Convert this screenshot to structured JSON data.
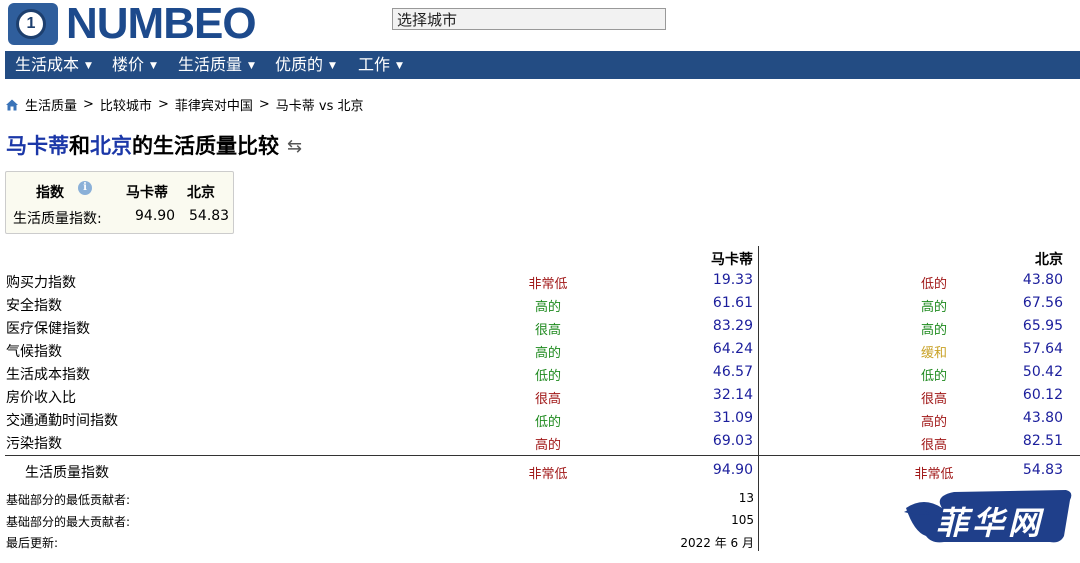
{
  "logo": {
    "text": "NUMBEO",
    "badge_glyph": "1"
  },
  "search": {
    "value": "选择城市"
  },
  "nav": [
    {
      "label": "生活成本"
    },
    {
      "label": "楼价"
    },
    {
      "label": "生活质量"
    },
    {
      "label": "优质的"
    },
    {
      "label": "工作"
    }
  ],
  "breadcrumb": [
    {
      "label": "生活质量"
    },
    {
      "label": "比较城市"
    },
    {
      "label": "菲律宾对中国"
    },
    {
      "label": "马卡蒂 vs 北京"
    }
  ],
  "title": {
    "city1": "马卡蒂",
    "conj": "和",
    "city2": "北京",
    "suffix": "的生活质量比较"
  },
  "summary": {
    "header_index": "指数",
    "header_city1": "马卡蒂",
    "header_city2": "北京",
    "label": "生活质量指数:",
    "value1": "94.90",
    "value2": "54.83"
  },
  "table": {
    "city1": "马卡蒂",
    "city2": "北京",
    "rows": [
      {
        "label": "购买力指数",
        "q1": "非常低",
        "q1_color": "#a01818",
        "v1": "19.33",
        "q2": "低的",
        "q2_color": "#a01818",
        "v2": "43.80"
      },
      {
        "label": "安全指数",
        "q1": "高的",
        "q1_color": "#1f8a1f",
        "v1": "61.61",
        "q2": "高的",
        "q2_color": "#1f8a1f",
        "v2": "67.56"
      },
      {
        "label": "医疗保健指数",
        "q1": "很高",
        "q1_color": "#1f8a1f",
        "v1": "83.29",
        "q2": "高的",
        "q2_color": "#1f8a1f",
        "v2": "65.95"
      },
      {
        "label": "气候指数",
        "q1": "高的",
        "q1_color": "#1f8a1f",
        "v1": "64.24",
        "q2": "缓和",
        "q2_color": "#c9a227",
        "v2": "57.64"
      },
      {
        "label": "生活成本指数",
        "q1": "低的",
        "q1_color": "#1f8a1f",
        "v1": "46.57",
        "q2": "低的",
        "q2_color": "#1f8a1f",
        "v2": "50.42"
      },
      {
        "label": "房价收入比",
        "q1": "很高",
        "q1_color": "#a01818",
        "v1": "32.14",
        "q2": "很高",
        "q2_color": "#a01818",
        "v2": "60.12"
      },
      {
        "label": "交通通勤时间指数",
        "q1": "低的",
        "q1_color": "#1f8a1f",
        "v1": "31.09",
        "q2": "高的",
        "q2_color": "#a01818",
        "v2": "43.80"
      },
      {
        "label": "污染指数",
        "q1": "高的",
        "q1_color": "#a01818",
        "v1": "69.03",
        "q2": "很高",
        "q2_color": "#a01818",
        "v2": "82.51"
      }
    ],
    "total": {
      "label": "生活质量指数",
      "q1": "非常低",
      "q1_color": "#a01818",
      "v1": "94.90",
      "q2": "非常低",
      "q2_color": "#a01818",
      "v2": "54.83"
    },
    "meta": [
      {
        "label": "基础部分的最低贡献者:",
        "value": "13"
      },
      {
        "label": "基础部分的最大贡献者:",
        "value": "105"
      },
      {
        "label": "最后更新:",
        "value": "2022 年 6 月"
      }
    ]
  },
  "watermark": {
    "text": "菲华网"
  }
}
